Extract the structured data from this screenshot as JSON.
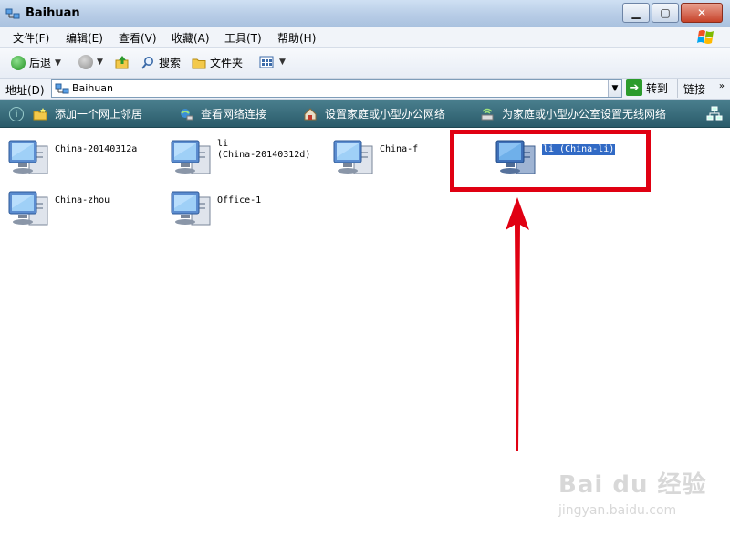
{
  "window": {
    "title": "Baihuan"
  },
  "menu": [
    {
      "label": "文件(F)"
    },
    {
      "label": "编辑(E)"
    },
    {
      "label": "查看(V)"
    },
    {
      "label": "收藏(A)"
    },
    {
      "label": "工具(T)"
    },
    {
      "label": "帮助(H)"
    }
  ],
  "toolbar": {
    "back_label": "后退",
    "search_label": "搜索",
    "folders_label": "文件夹"
  },
  "address": {
    "label": "地址(D)",
    "value": "Baihuan",
    "go_label": "转到",
    "links_label": "链接"
  },
  "tasks": [
    {
      "label": "添加一个网上邻居",
      "icon": "add-network-place-icon"
    },
    {
      "label": "查看网络连接",
      "icon": "network-connections-icon"
    },
    {
      "label": "设置家庭或小型办公网络",
      "icon": "home-network-icon"
    },
    {
      "label": "为家庭或小型办公室设置无线网络",
      "icon": "wireless-network-icon"
    }
  ],
  "computers": [
    {
      "label": "China-20140312a",
      "selected": false
    },
    {
      "label": "li\n(China-20140312d)",
      "selected": false
    },
    {
      "label": "China-f",
      "selected": false
    },
    {
      "label": "li (China-li)",
      "selected": true
    },
    {
      "label": "China-zhou",
      "selected": false
    },
    {
      "label": "Office-1",
      "selected": false
    }
  ],
  "colors": {
    "highlight": "#e00012",
    "selection": "#316ac5",
    "taskbar": "#2a5b6a"
  },
  "watermark": {
    "line1": "Bai du 经验",
    "line2": "jingyan.baidu.com"
  }
}
